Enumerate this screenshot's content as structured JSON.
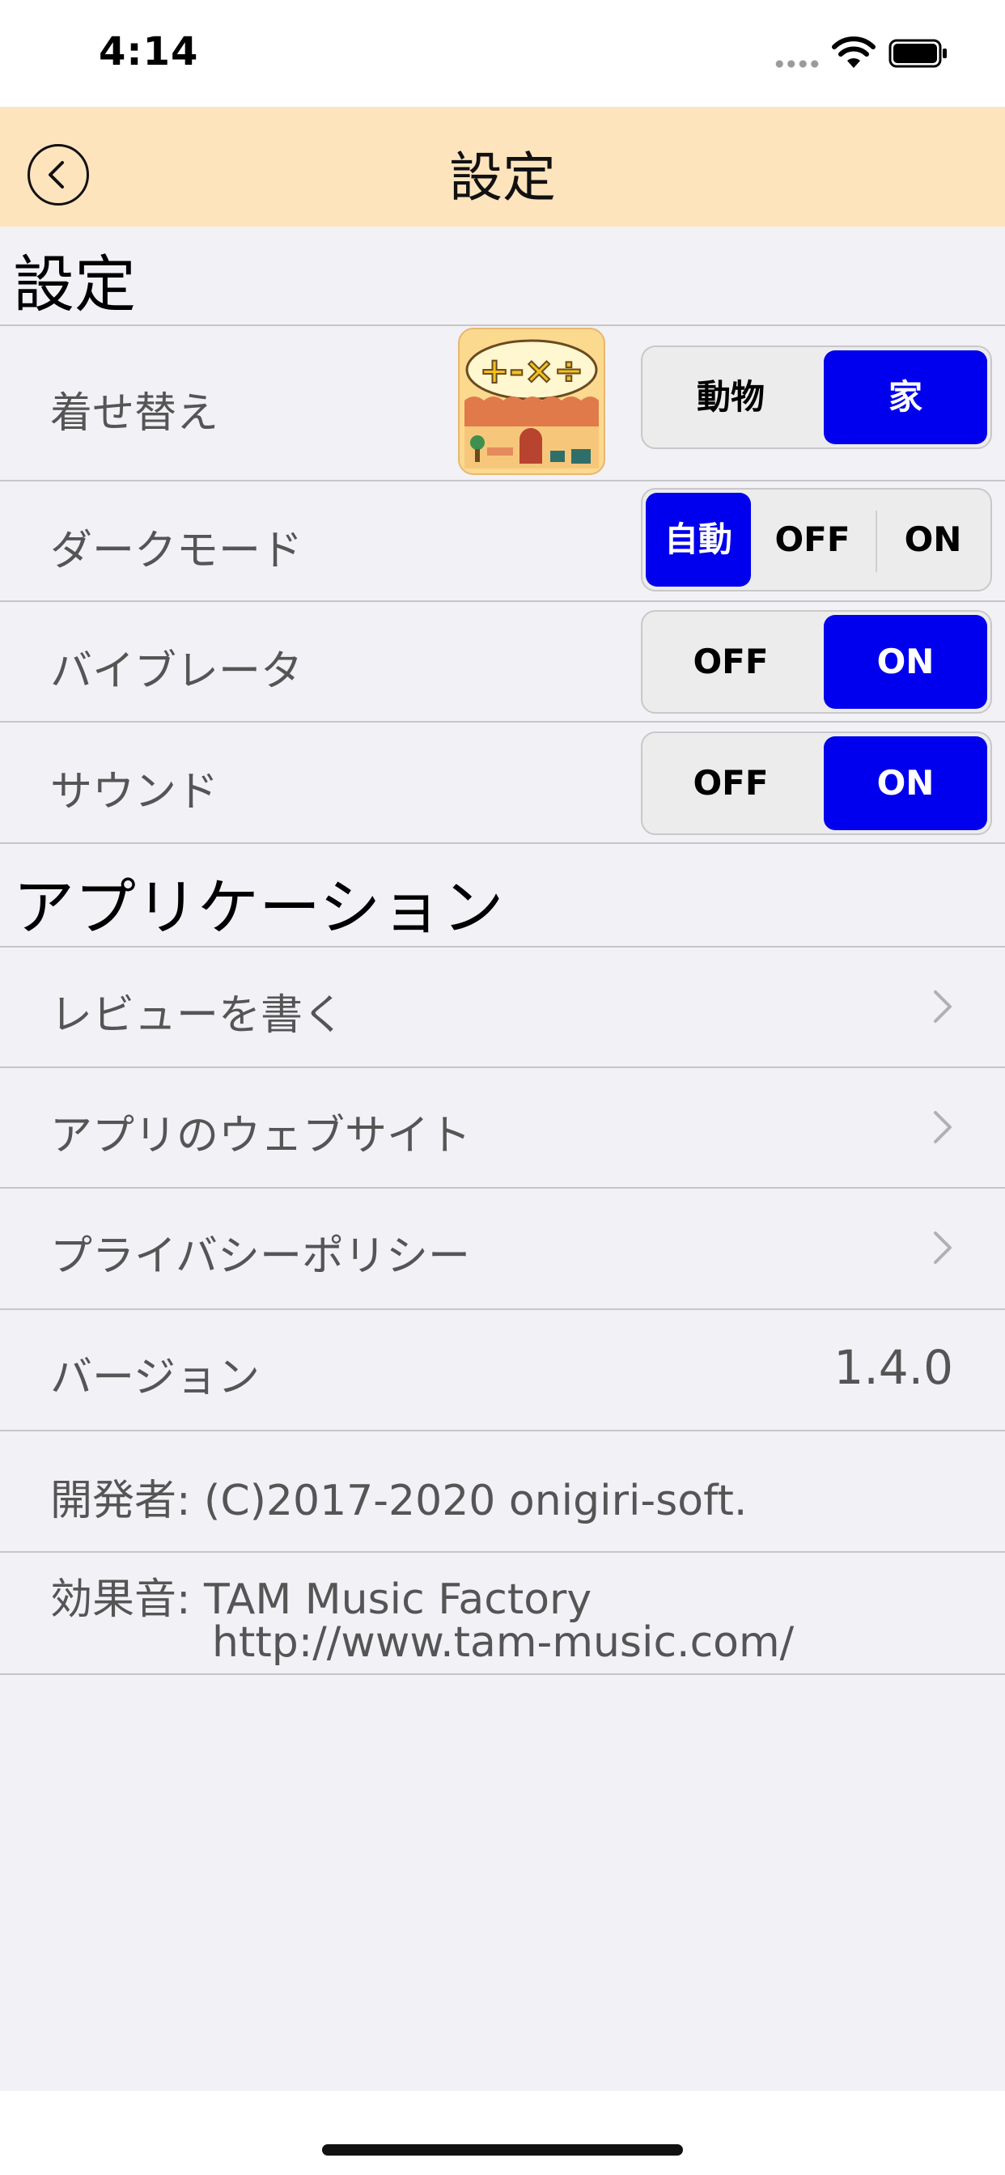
{
  "status": {
    "time": "4:14"
  },
  "nav": {
    "title": "設定"
  },
  "sections": {
    "settings": "設定",
    "application": "アプリケーション"
  },
  "settings": {
    "theme": {
      "label": "着せ替え",
      "options": [
        "動物",
        "家"
      ],
      "selected": "家"
    },
    "dark_mode": {
      "label": "ダークモード",
      "options": [
        "自動",
        "OFF",
        "ON"
      ],
      "selected": "自動"
    },
    "vibrator": {
      "label": "バイブレータ",
      "options": [
        "OFF",
        "ON"
      ],
      "selected": "ON"
    },
    "sound": {
      "label": "サウンド",
      "options": [
        "OFF",
        "ON"
      ],
      "selected": "ON"
    }
  },
  "application": {
    "review": "レビューを書く",
    "website": "アプリのウェブサイト",
    "privacy": "プライバシーポリシー",
    "version_label": "バージョン",
    "version_value": "1.4.0",
    "developer": "開発者: (C)2017-2020 onigiri-soft.",
    "sound_credit": "効果音: TAM Music Factory",
    "sound_credit_url": "http://www.tam-music.com/"
  },
  "colors": {
    "nav_bg": "#fde4bd",
    "selected": "#0000ee",
    "background": "#f2f1f6"
  }
}
